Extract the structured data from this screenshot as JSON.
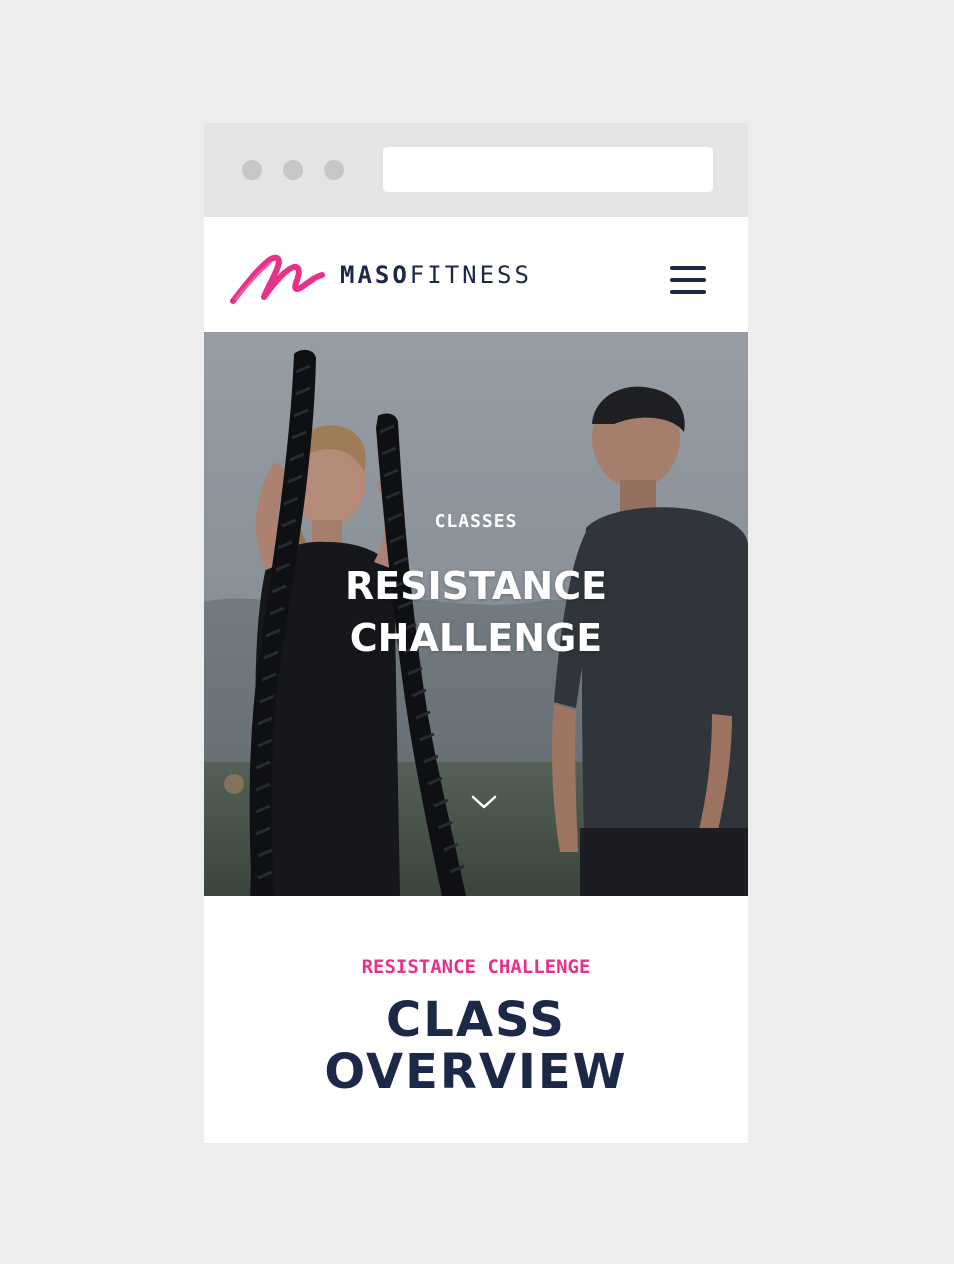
{
  "colors": {
    "page_background": "#ededed",
    "browser_chrome": "#e3e4e6",
    "navy": "#1c2848",
    "brand_pink": "#e8318a",
    "white": "#ffffff"
  },
  "navbar": {
    "logo_bold": "MASO",
    "logo_light": "FITNESS",
    "logo_icon": "maso-brushstroke-m-icon",
    "menu_icon": "hamburger-menu-icon"
  },
  "hero": {
    "kicker": "CLASSES",
    "title_line1": "RESISTANCE",
    "title_line2": "CHALLENGE",
    "scroll_icon": "chevron-down-icon"
  },
  "overview": {
    "kicker": "RESISTANCE CHALLENGE",
    "title_line1": "CLASS",
    "title_line2": "OVERVIEW"
  }
}
